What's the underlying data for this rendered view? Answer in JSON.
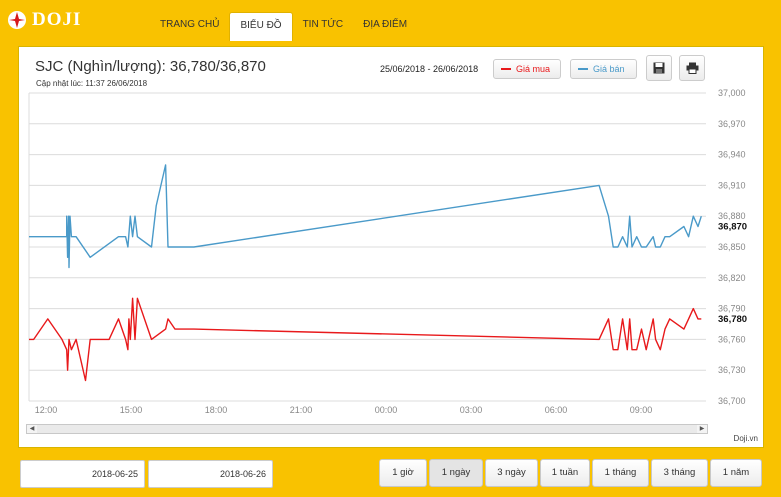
{
  "brand": {
    "logo_text": "DOJI"
  },
  "nav": {
    "items": [
      {
        "label": "TRANG CHỦ"
      },
      {
        "label": "BIỂU ĐỒ"
      },
      {
        "label": "TIN TỨC"
      },
      {
        "label": "ĐỊA ĐIỂM"
      }
    ],
    "active": "BIỂU ĐỒ"
  },
  "header": {
    "title": "SJC (Nghìn/lượng): 36,780/36,870",
    "updated": "Cập nhật lúc: 11:37 26/06/2018",
    "date_range": "25/06/2018 - 26/06/2018",
    "legend_buy": "Giá mua",
    "legend_sell": "Giá bán"
  },
  "colors": {
    "buy": "#e8191b",
    "sell": "#4a9ac9",
    "brand": "#f9c200"
  },
  "icons": {
    "save": "save-icon",
    "print": "print-icon",
    "logo": "doji-logo-icon"
  },
  "credit": "Doji.vn",
  "date_inputs": {
    "from": "2018-06-25",
    "to": "2018-06-26"
  },
  "ranges": [
    "1 giờ",
    "1 ngày",
    "3 ngày",
    "1 tuần",
    "1 tháng",
    "3 tháng",
    "1 năm"
  ],
  "active_range": "1 ngày",
  "chart_data": {
    "type": "line",
    "grid": true,
    "ylim": [
      36700,
      37000
    ],
    "y_ticks": [
      "37,000",
      "36,970",
      "36,940",
      "36,910",
      "36,880",
      "36,850",
      "36,820",
      "36,790",
      "36,760",
      "36,730",
      "36,700"
    ],
    "x_ticks": [
      "12:00",
      "15:00",
      "18:00",
      "21:00",
      "00:00",
      "03:00",
      "06:00",
      "09:00"
    ],
    "current_labels": {
      "sell": "36,870",
      "buy": "36,780"
    },
    "series": [
      {
        "name": "Giá bán",
        "x": [
          "11:50",
          "12:00",
          "13:10",
          "13:10",
          "13:12",
          "13:14",
          "13:15",
          "13:17",
          "13:20",
          "13:25",
          "13:30",
          "14:00",
          "15:00",
          "15:15",
          "15:20",
          "15:25",
          "15:30",
          "15:35",
          "15:40",
          "16:10",
          "16:20",
          "16:40",
          "16:45",
          "17:00",
          "17:40",
          "08:00",
          "08:20",
          "08:30",
          "08:40",
          "08:50",
          "09:00",
          "09:05",
          "09:10",
          "09:20",
          "09:30",
          "09:40",
          "09:55",
          "10:00",
          "10:10",
          "10:20",
          "10:30",
          "11:00",
          "11:10",
          "11:20",
          "11:30",
          "11:37"
        ],
        "y": [
          36860,
          36860,
          36860,
          36880,
          36840,
          36880,
          36830,
          36880,
          36860,
          36860,
          36860,
          36840,
          36860,
          36860,
          36850,
          36880,
          36860,
          36880,
          36860,
          36850,
          36890,
          36930,
          36850,
          36850,
          36850,
          36910,
          36880,
          36850,
          36850,
          36860,
          36850,
          36880,
          36850,
          36860,
          36850,
          36850,
          36860,
          36850,
          36850,
          36860,
          36860,
          36870,
          36860,
          36880,
          36870,
          36880
        ]
      },
      {
        "name": "Giá mua",
        "x": [
          "11:50",
          "12:00",
          "12:30",
          "13:00",
          "13:10",
          "13:12",
          "13:15",
          "13:20",
          "13:30",
          "13:50",
          "14:00",
          "14:40",
          "15:00",
          "15:15",
          "15:20",
          "15:22",
          "15:25",
          "15:30",
          "15:35",
          "15:40",
          "16:10",
          "16:40",
          "16:45",
          "17:00",
          "17:40",
          "08:00",
          "08:20",
          "08:30",
          "08:40",
          "08:50",
          "09:00",
          "09:05",
          "09:10",
          "09:20",
          "09:30",
          "09:40",
          "09:55",
          "10:00",
          "10:10",
          "10:20",
          "10:30",
          "11:00",
          "11:10",
          "11:20",
          "11:30",
          "11:37"
        ],
        "y": [
          36760,
          36760,
          36780,
          36760,
          36750,
          36730,
          36760,
          36750,
          36760,
          36720,
          36760,
          36760,
          36780,
          36760,
          36750,
          36780,
          36760,
          36800,
          36760,
          36800,
          36760,
          36770,
          36780,
          36770,
          36770,
          36760,
          36780,
          36750,
          36750,
          36780,
          36750,
          36780,
          36750,
          36750,
          36770,
          36750,
          36780,
          36760,
          36750,
          36770,
          36780,
          36770,
          36780,
          36790,
          36780,
          36780
        ]
      }
    ]
  }
}
